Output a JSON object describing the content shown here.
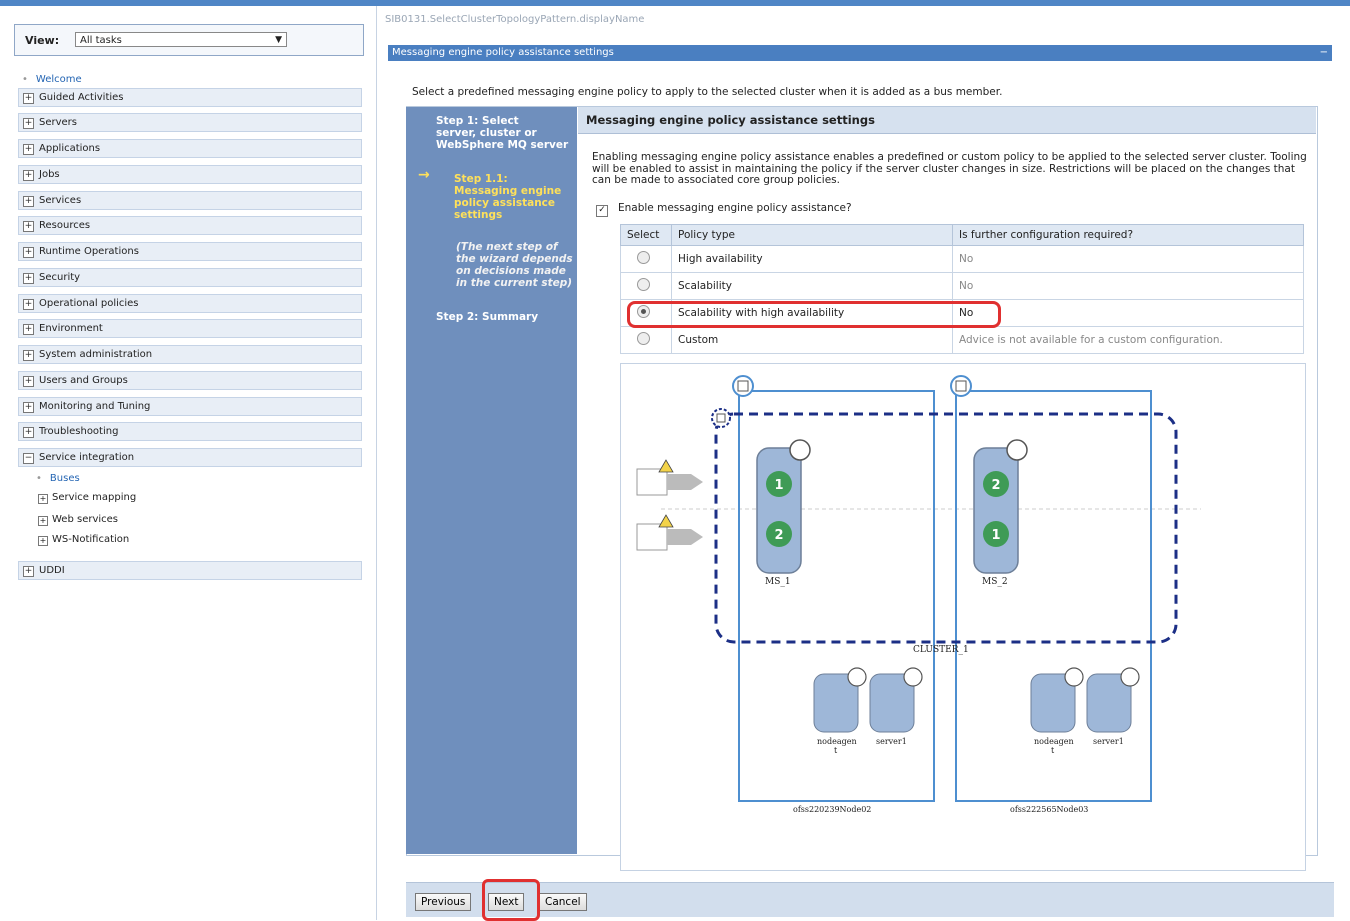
{
  "nav": {
    "view_label": "View:",
    "view_value": "All tasks",
    "welcome": "Welcome",
    "items": [
      {
        "label": "Guided Activities",
        "toggle": "+"
      },
      {
        "label": "Servers",
        "toggle": "+"
      },
      {
        "label": "Applications",
        "toggle": "+"
      },
      {
        "label": "Jobs",
        "toggle": "+"
      },
      {
        "label": "Services",
        "toggle": "+"
      },
      {
        "label": "Resources",
        "toggle": "+"
      },
      {
        "label": "Runtime Operations",
        "toggle": "+"
      },
      {
        "label": "Security",
        "toggle": "+"
      },
      {
        "label": "Operational policies",
        "toggle": "+"
      },
      {
        "label": "Environment",
        "toggle": "+"
      },
      {
        "label": "System administration",
        "toggle": "+"
      },
      {
        "label": "Users and Groups",
        "toggle": "+"
      },
      {
        "label": "Monitoring and Tuning",
        "toggle": "+"
      },
      {
        "label": "Troubleshooting",
        "toggle": "+"
      },
      {
        "label": "Service integration",
        "toggle": "−"
      }
    ],
    "service_integration_children": {
      "buses": "Buses",
      "service_mapping": "Service mapping",
      "web_services": "Web services",
      "ws_notification": "WS-Notification"
    },
    "uddi": "UDDI"
  },
  "header": {
    "breadcrumb": "SIB0131.SelectClusterTopologyPattern.displayName",
    "panel_title": "Messaging engine policy assistance settings"
  },
  "intro": "Select a predefined messaging engine policy to apply to the selected cluster when it is added as a bus member.",
  "steps": {
    "step1": [
      "Step 1: Select",
      "server, cluster or",
      "WebSphere MQ server"
    ],
    "step11": [
      "Step 1.1:",
      "Messaging engine",
      "policy assistance",
      "settings"
    ],
    "note": [
      "(The next step of",
      "the wizard depends",
      "on decisions made",
      "in the current step)"
    ],
    "step2": "Step 2: Summary",
    "arrow": "→"
  },
  "content": {
    "title": "Messaging engine policy assistance settings",
    "description": "Enabling messaging engine policy assistance enables a predefined or custom policy to be applied to the selected server cluster. Tooling will be enabled to assist in maintaining the policy if the server cluster changes in size. Restrictions will be placed on the changes that can be made to associated core group policies.",
    "enable_label": "Enable messaging engine policy assistance?",
    "enable_checked": true
  },
  "table": {
    "headers": [
      "Select",
      "Policy type",
      "Is further configuration required?"
    ],
    "rows": [
      {
        "policy": "High availability",
        "config": "No",
        "selected": false
      },
      {
        "policy": "Scalability",
        "config": "No",
        "selected": false
      },
      {
        "policy": "Scalability with high availability",
        "config": "No",
        "selected": true
      },
      {
        "policy": "Custom",
        "config": "Advice is not available for a custom configuration.",
        "selected": false
      }
    ]
  },
  "diagram": {
    "ms1": "MS_1",
    "ms2": "MS_2",
    "cluster": "CLUSTER_1",
    "node1": "ofss220239Node02",
    "node2": "ofss222565Node03",
    "nodeagent_a": "nodeagen",
    "nodeagent_b": "t",
    "server1": "server1",
    "badge1": "1",
    "badge2": "2"
  },
  "buttons": {
    "previous": "Previous",
    "next": "Next",
    "cancel": "Cancel"
  },
  "colors": {
    "nav_bg": "#e8eef6",
    "wizard_steps_bg": "#6f8fbd",
    "current_step": "#ffe15a",
    "highlight": "#e03030",
    "badge_green": "#3f9b56",
    "cluster_dash": "#1c2f86"
  }
}
